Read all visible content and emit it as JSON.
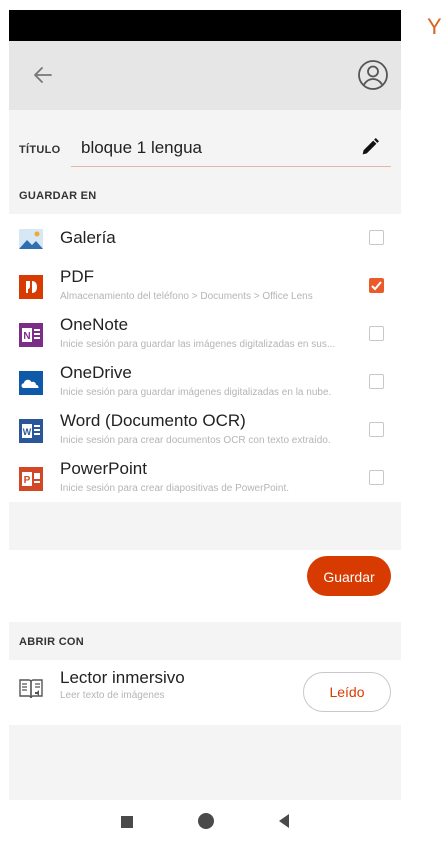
{
  "header": {
    "back_icon": "arrow-left-icon",
    "account_icon": "account-circle-icon"
  },
  "title_section": {
    "label": "TÍTULO",
    "value": "bloque 1 lengua",
    "edit_icon": "pencil-icon"
  },
  "save_to": {
    "header": "GUARDAR EN",
    "items": [
      {
        "name": "Galería",
        "subtitle": "",
        "icon": "gallery-icon",
        "checked": false
      },
      {
        "name": "PDF",
        "subtitle": "Almacenamiento del teléfono > Documents > Office Lens",
        "icon": "pdf-icon",
        "checked": true
      },
      {
        "name": "OneNote",
        "subtitle": "Inicie sesión para guardar las imágenes digitalizadas en sus...",
        "icon": "onenote-icon",
        "checked": false
      },
      {
        "name": "OneDrive",
        "subtitle": "Inicie sesión para guardar imágenes digitalizadas en la nube.",
        "icon": "onedrive-icon",
        "checked": false
      },
      {
        "name": "Word (Documento OCR)",
        "subtitle": "Inicie sesión para crear documentos OCR con texto extraído.",
        "icon": "word-icon",
        "checked": false
      },
      {
        "name": "PowerPoint",
        "subtitle": "Inicie sesión para crear diapositivas de PowerPoint.",
        "icon": "powerpoint-icon",
        "checked": false
      }
    ],
    "save_button": "Guardar"
  },
  "open_with": {
    "header": "ABRIR CON",
    "item": {
      "name": "Lector inmersivo",
      "subtitle": "Leer texto de imágenes",
      "icon": "immersive-reader-icon",
      "button": "Leído"
    }
  },
  "side_text": "Y",
  "colors": {
    "accent": "#d83b01",
    "checkbox_checked": "#ea5b2c",
    "pdf": "#d83b01",
    "onenote": "#7b2e86",
    "onedrive": "#0f5aa8",
    "word": "#2b579a",
    "powerpoint": "#d24726"
  }
}
